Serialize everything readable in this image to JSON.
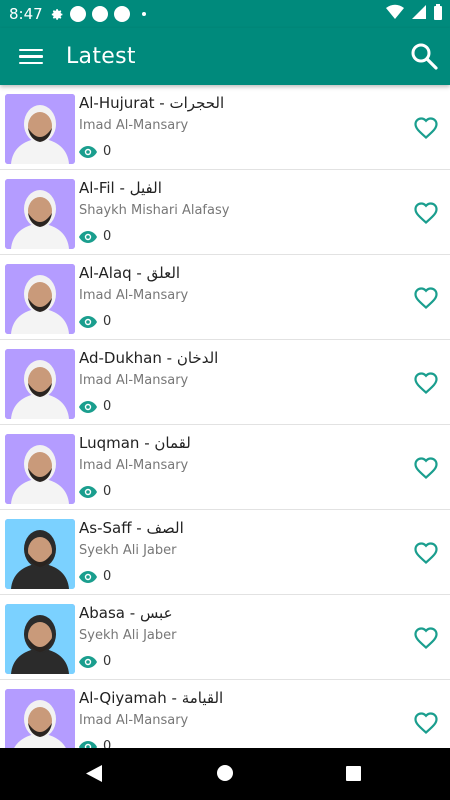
{
  "status_bar": {
    "time": "8:47",
    "icons_left": [
      "gear-icon",
      "circle-icon",
      "circle-icon",
      "circle-icon",
      "dot-icon"
    ],
    "icons_right": [
      "wifi-icon",
      "cell-signal-icon",
      "battery-icon"
    ]
  },
  "app_bar": {
    "title": "Latest",
    "menu_icon": "hamburger-menu-icon",
    "search_icon": "search-icon",
    "color": "#008a7c"
  },
  "list": [
    {
      "title": "Al-Hujurat - الحجرات",
      "reciter": "Imad Al-Mansary",
      "views": "0",
      "avatar": "reciter-a"
    },
    {
      "title": "Al-Fil - الفيل",
      "reciter": "Shaykh Mishari Alafasy",
      "views": "0",
      "avatar": "reciter-b"
    },
    {
      "title": "Al-Alaq - العلق",
      "reciter": "Imad Al-Mansary",
      "views": "0",
      "avatar": "reciter-a"
    },
    {
      "title": "Ad-Dukhan - الدخان",
      "reciter": "Imad Al-Mansary",
      "views": "0",
      "avatar": "reciter-a"
    },
    {
      "title": "Luqman - لقمان",
      "reciter": "Imad Al-Mansary",
      "views": "0",
      "avatar": "reciter-a"
    },
    {
      "title": "As-Saff - الصف",
      "reciter": "Syekh Ali Jaber",
      "views": "0",
      "avatar": "reciter-c"
    },
    {
      "title": "Abasa - عبس",
      "reciter": "Syekh Ali Jaber",
      "views": "0",
      "avatar": "reciter-c"
    },
    {
      "title": "Al-Qiyamah - القيامة",
      "reciter": "Imad Al-Mansary",
      "views": "0",
      "avatar": "reciter-a"
    }
  ],
  "accent_color": "#1a9e8e",
  "nav_bar": {
    "buttons": [
      "back-icon",
      "home-icon",
      "recents-icon"
    ]
  }
}
